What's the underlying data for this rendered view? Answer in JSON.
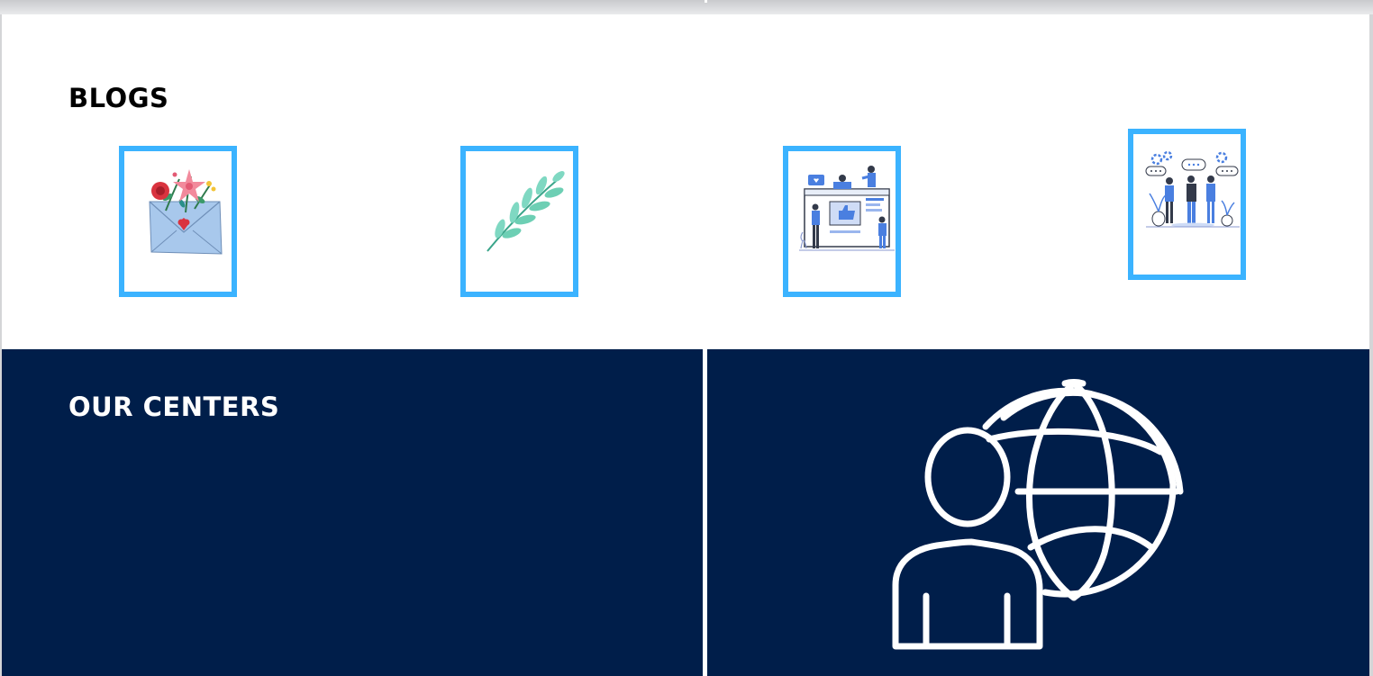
{
  "blogs": {
    "title": "BLOGS",
    "cards": [
      {
        "icon": "flowers-envelope-icon"
      },
      {
        "icon": "leaf-branch-icon"
      },
      {
        "icon": "social-media-team-icon"
      },
      {
        "icon": "team-discussion-icon"
      }
    ]
  },
  "centers": {
    "title": "OUR CENTERS",
    "icon": "person-globe-icon"
  },
  "colors": {
    "card_border": "#3bb3ff",
    "centers_bg": "#001e4a",
    "illustration_blue": "#4a7fe0"
  }
}
